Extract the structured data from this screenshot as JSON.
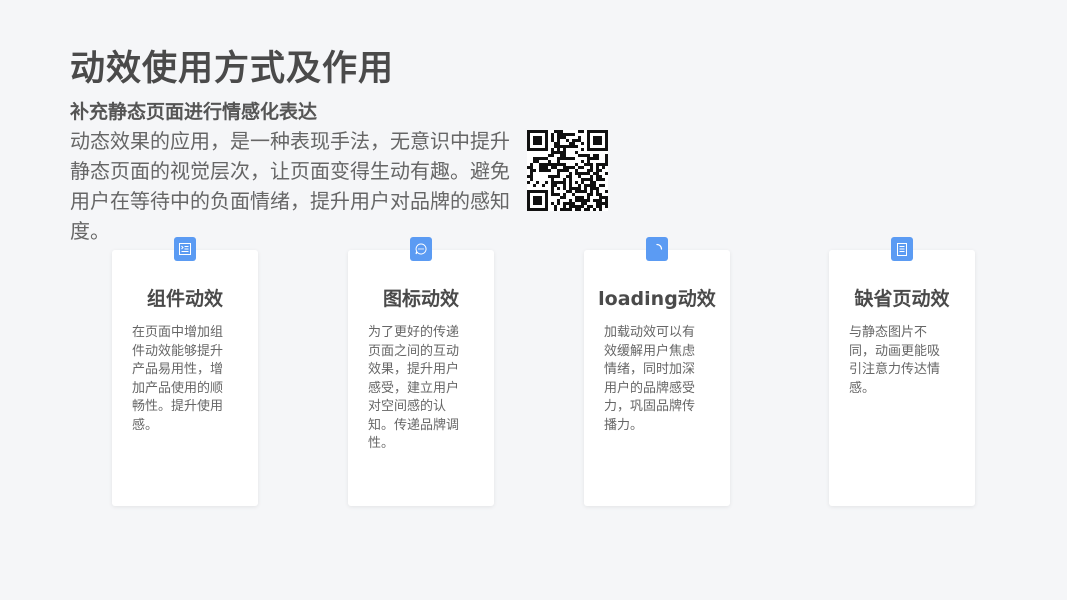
{
  "title": "动效使用方式及作用",
  "subtitle": "补充静态页面进行情感化表达",
  "intro": "动态效果的应用，是一种表现手法，无意识中提升静态页面的视觉层次，让页面变得生动有趣。避免用户在等待中的负面情绪，提升用户对品牌的感知度。",
  "accent_color": "#5b9bf3",
  "cards": [
    {
      "icon": "list-icon",
      "title": "组件动效",
      "desc": "在页面中增加组件动效能够提升产品易用性，增加产品使用的顺畅性。提升使用感。"
    },
    {
      "icon": "chat-bubble-icon",
      "title": "图标动效",
      "desc": "为了更好的传递页面之间的互动效果，提升用户感受，建立用户对空间感的认知。传递品牌调性。"
    },
    {
      "icon": "loading-spinner-icon",
      "title": "loading动效",
      "desc": "加载动效可以有效缓解用户焦虑情绪，同时加深用户的品牌感受力，巩固品牌传播力。"
    },
    {
      "icon": "document-icon",
      "title": "缺省页动效",
      "desc": "与静态图片不同，动画更能吸引注意力传达情感。"
    }
  ]
}
